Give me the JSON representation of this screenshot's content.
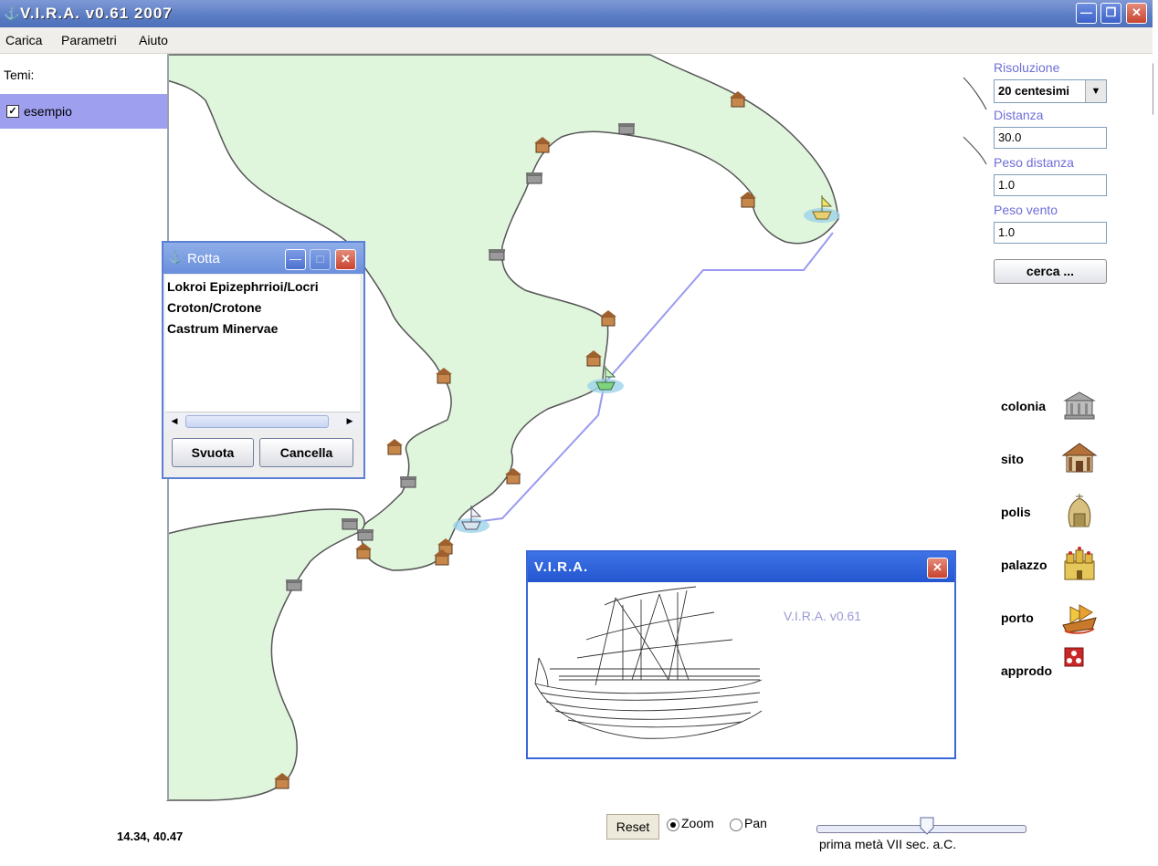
{
  "window": {
    "title": "V.I.R.A. v0.61 2007"
  },
  "menu": {
    "items": [
      "Carica",
      "Parametri",
      "Aiuto"
    ]
  },
  "themes": {
    "label": "Temi:",
    "items": [
      {
        "name": "esempio",
        "checked": true
      }
    ]
  },
  "params": {
    "resolution_label": "Risoluzione",
    "resolution_value": "20 centesimi",
    "distance_label": "Distanza",
    "distance_value": "30.0",
    "distance_weight_label": "Peso distanza",
    "distance_weight_value": "1.0",
    "wind_weight_label": "Peso vento",
    "wind_weight_value": "1.0",
    "search_button": "cerca ..."
  },
  "legend": {
    "items": [
      {
        "label": "colonia",
        "icon": "colonia-icon"
      },
      {
        "label": "sito",
        "icon": "sito-icon"
      },
      {
        "label": "polis",
        "icon": "polis-icon"
      },
      {
        "label": "palazzo",
        "icon": "palazzo-icon"
      },
      {
        "label": "porto",
        "icon": "porto-icon"
      },
      {
        "label": "approdo",
        "icon": "approdo-icon"
      }
    ]
  },
  "route_window": {
    "title": "Rotta",
    "items": [
      "Lokroi Epizephrrioi/Locri",
      "Croton/Crotone",
      "Castrum Minervae"
    ],
    "clear_button": "Svuota",
    "delete_button": "Cancella"
  },
  "about_window": {
    "title": "V.I.R.A.",
    "version": "V.I.R.A. v0.61"
  },
  "status": {
    "coords": "14.34, 40.47",
    "reset_button": "Reset",
    "mode_options": [
      {
        "label": "Zoom",
        "selected": true
      },
      {
        "label": "Pan",
        "selected": false
      }
    ],
    "period_label": "prima metà VII sec. a.C.",
    "period_slider_position": 0.53
  },
  "colors": {
    "land": "#dff5dc",
    "route": "#9a9af0",
    "selection": "#9f9ff0",
    "param_label": "#6e6ed8"
  }
}
